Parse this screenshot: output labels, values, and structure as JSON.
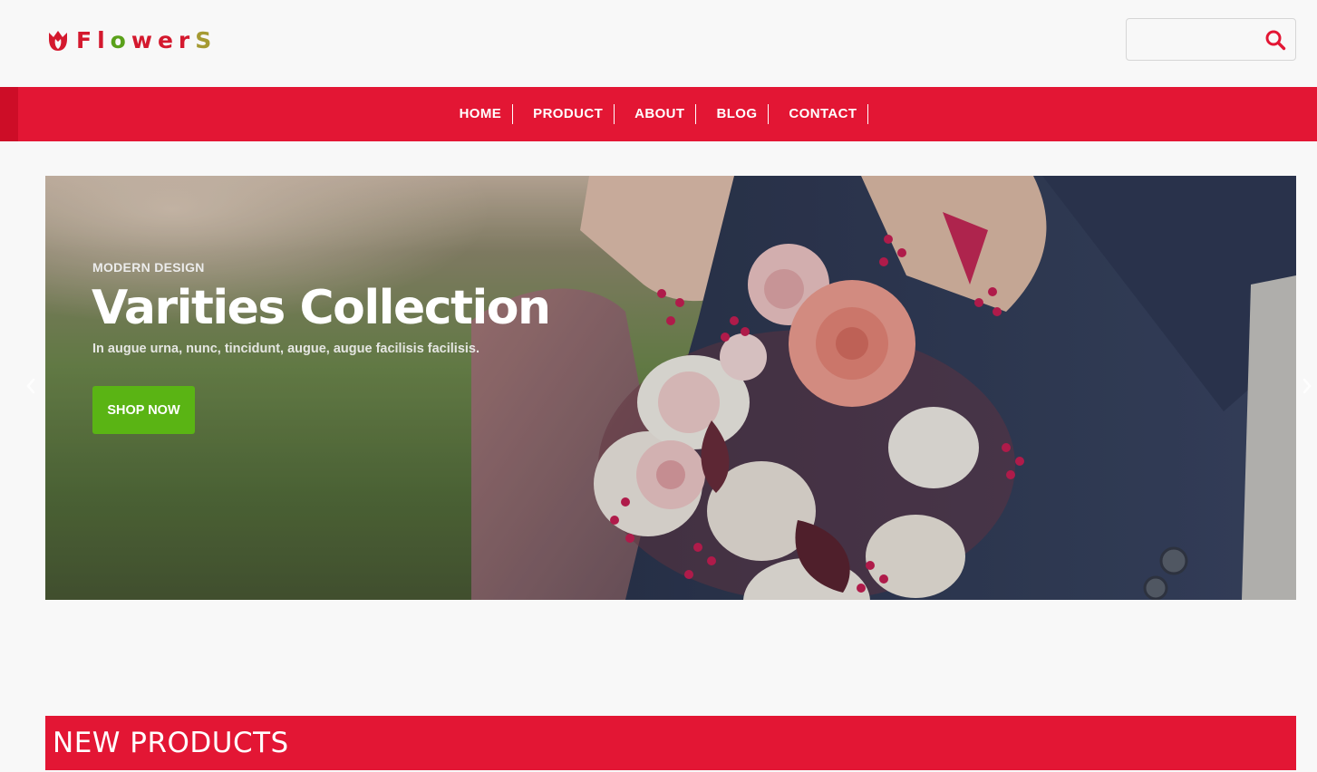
{
  "brand": {
    "letters": [
      {
        "char": "F",
        "color": "#d4192e"
      },
      {
        "char": "l",
        "color": "#d4192e"
      },
      {
        "char": "o",
        "color": "#5aa11a"
      },
      {
        "char": "w",
        "color": "#d4192e"
      },
      {
        "char": "e",
        "color": "#d4192e"
      },
      {
        "char": "r",
        "color": "#d4192e"
      },
      {
        "char": "S",
        "color": "#a59a32"
      }
    ],
    "icon": "tulip-icon"
  },
  "search": {
    "placeholder": "",
    "value": "",
    "icon": "search-icon"
  },
  "nav": {
    "items": [
      {
        "label": "HOME"
      },
      {
        "label": "PRODUCT"
      },
      {
        "label": "ABOUT"
      },
      {
        "label": "BLOG"
      },
      {
        "label": "CONTACT"
      }
    ]
  },
  "hero": {
    "subtitle": "MODERN DESIGN",
    "title": "Varities Collection",
    "description": "In augue urna, nunc, tincidunt, augue, augue facilisis facilisis.",
    "cta_label": "SHOP NOW",
    "prev_icon": "chevron-left-icon",
    "next_icon": "chevron-right-icon"
  },
  "sections": {
    "new_products_title": "NEW PRODUCTS"
  },
  "colors": {
    "brand_red": "#e31634",
    "nav_accent": "#cd0d27",
    "cta_green": "#5ab414",
    "background": "#f8f8f8"
  }
}
